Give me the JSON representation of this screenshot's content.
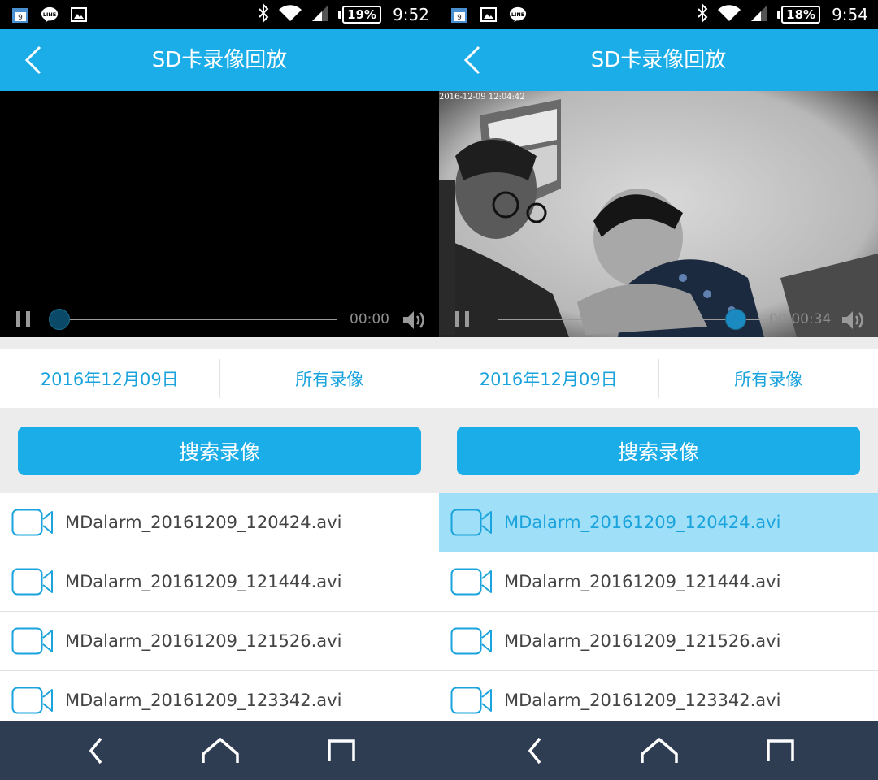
{
  "panels": [
    {
      "status": {
        "battery": "19%",
        "time": "9:52"
      },
      "header": {
        "title": "SD卡录像回放"
      },
      "player": {
        "time": "00:00",
        "progress": 0.0,
        "has_video": false,
        "timestamp": ""
      },
      "filters": {
        "date": "2016年12月09日",
        "type": "所有录像"
      },
      "search_label": "搜索录像",
      "files": [
        {
          "name": "MDalarm_20161209_120424.avi",
          "selected": false
        },
        {
          "name": "MDalarm_20161209_121444.avi",
          "selected": false
        },
        {
          "name": "MDalarm_20161209_121526.avi",
          "selected": false
        },
        {
          "name": "MDalarm_20161209_123342.avi",
          "selected": false
        }
      ]
    },
    {
      "status": {
        "battery": "18%",
        "time": "9:54"
      },
      "header": {
        "title": "SD卡录像回放"
      },
      "player": {
        "time": "00:00:34",
        "progress": 0.85,
        "has_video": true,
        "timestamp": "2016-12-09 12:04:42"
      },
      "filters": {
        "date": "2016年12月09日",
        "type": "所有录像"
      },
      "search_label": "搜索录像",
      "files": [
        {
          "name": "MDalarm_20161209_120424.avi",
          "selected": true
        },
        {
          "name": "MDalarm_20161209_121444.avi",
          "selected": false
        },
        {
          "name": "MDalarm_20161209_121526.avi",
          "selected": false
        },
        {
          "name": "MDalarm_20161209_123342.avi",
          "selected": false
        }
      ]
    }
  ],
  "icons": {
    "status_left": [
      "calendar-icon",
      "line-app-icon",
      "gallery-icon"
    ],
    "status_right": [
      "bluetooth-icon",
      "wifi-icon",
      "signal-icon",
      "battery-icon"
    ],
    "header": "back-arrow-icon",
    "player": [
      "pause-icon",
      "volume-icon"
    ],
    "file": "video-camera-icon",
    "nav": [
      "nav-back-icon",
      "nav-home-icon",
      "nav-recents-icon"
    ]
  },
  "colors": {
    "accent": "#1aade8",
    "accent_text": "#1aa3dc",
    "selected_row": "#9fe0f8",
    "navbar": "#2e3d52"
  }
}
